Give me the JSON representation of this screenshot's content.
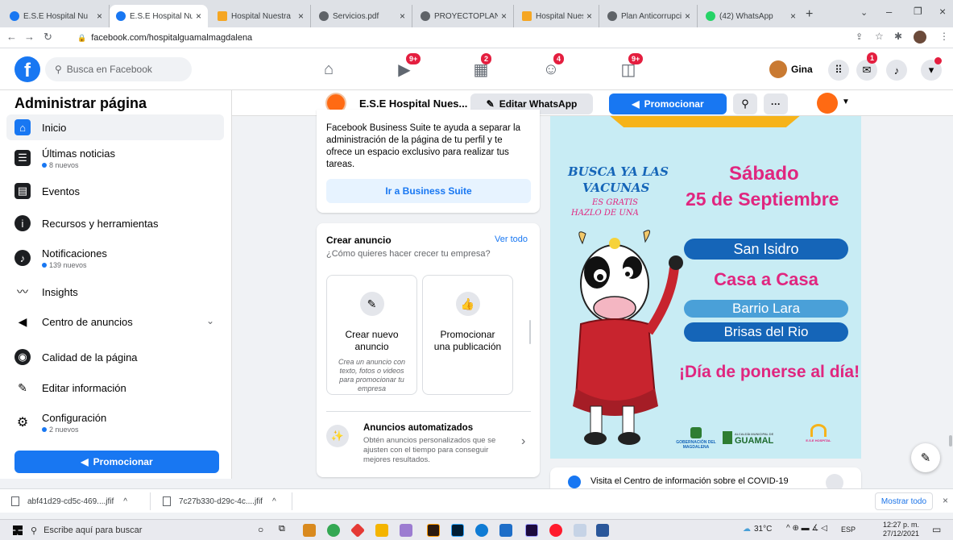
{
  "browser": {
    "tabs": [
      {
        "label": "E.S.E Hospital Nu",
        "active": false
      },
      {
        "label": "E.S.E Hospital Nu",
        "active": true
      },
      {
        "label": "Hospital Nuestra",
        "active": false
      },
      {
        "label": "Servicios.pdf",
        "active": false
      },
      {
        "label": "PROYECTOPLANC",
        "active": false
      },
      {
        "label": "Hospital Nuestra",
        "active": false
      },
      {
        "label": "Plan Anticorrupci",
        "active": false
      },
      {
        "label": "(42) WhatsApp",
        "active": false
      }
    ],
    "new_tab": "+",
    "url": "facebook.com/hospitalguamalmagdalena"
  },
  "fb_topbar": {
    "search_placeholder": "Busca en Facebook",
    "badges": {
      "watch": "9+",
      "marketplace": "2",
      "groups": "4",
      "gaming": "9+",
      "messenger": "1"
    },
    "user_name": "Gina"
  },
  "sidebar": {
    "title": "Administrar página",
    "items": [
      {
        "label": "Inicio",
        "sub": ""
      },
      {
        "label": "Últimas noticias",
        "sub": "8 nuevos"
      },
      {
        "label": "Eventos",
        "sub": ""
      },
      {
        "label": "Recursos y herramientas",
        "sub": ""
      },
      {
        "label": "Notificaciones",
        "sub": "139 nuevos"
      },
      {
        "label": "Insights",
        "sub": ""
      },
      {
        "label": "Centro de anuncios",
        "sub": ""
      },
      {
        "label": "Calidad de la página",
        "sub": ""
      },
      {
        "label": "Editar información",
        "sub": ""
      },
      {
        "label": "Configuración",
        "sub": "2 nuevos"
      }
    ],
    "promote_button": "Promocionar"
  },
  "page_header": {
    "page_name": "E.S.E Hospital Nues...",
    "edit_whatsapp": "Editar WhatsApp",
    "promote": "Promocionar",
    "more": "···"
  },
  "business_suite_card": {
    "text": "Facebook Business Suite te ayuda a separar la administración de la página de tu perfil y te ofrece un espacio exclusivo para realizar tus tareas.",
    "button": "Ir a Business Suite"
  },
  "create_ad_card": {
    "title": "Crear anuncio",
    "see_all": "Ver todo",
    "subtitle": "¿Cómo quieres hacer crecer tu empresa?",
    "options": [
      {
        "title": "Crear nuevo anuncio",
        "desc": "Crea un anuncio con texto, fotos o videos para promocionar tu empresa"
      },
      {
        "title": "Promocionar una publicación",
        "desc": ""
      }
    ],
    "automated": {
      "title": "Anuncios automatizados",
      "desc": "Obtén anuncios personalizados que se ajusten con el tiempo para conseguir mejores resultados."
    }
  },
  "poster": {
    "left_text_1": "BUSCA YA LAS",
    "left_text_2": "VACUNAS",
    "left_text_3": "ES GRATIS",
    "left_text_4": "HAZLO DE UNA",
    "day": "Sábado",
    "date": "25 de Septiembre",
    "place_1": "San Isidro",
    "place_2": "Casa a Casa",
    "place_3": "Barrio Lara",
    "place_4": "Brisas del Rio",
    "slogan": "¡Día de ponerse al día!",
    "logo_1": "GOBERNACIÓN DEL MAGDALENA",
    "logo_2": "GUAMAL",
    "logo_2_top": "ALCALDÍA MUNICIPAL DE",
    "logo_3": "E.S.E HOSPITAL",
    "colors": {
      "bg": "#c8ecf4",
      "pink": "#e0267f",
      "blue": "#1565b8"
    }
  },
  "covid_banner": "Visita el Centro de información sobre el COVID-19",
  "downloads": {
    "items": [
      "abf41d29-cd5c-469....jfif",
      "7c27b330-d29c-4c....jfif"
    ],
    "show_all": "Mostrar todo"
  },
  "taskbar": {
    "search_placeholder": "Escribe aquí para buscar",
    "weather": "31°C",
    "lang": "ESP",
    "time": "12:27 p. m.",
    "date": "27/12/2021"
  }
}
